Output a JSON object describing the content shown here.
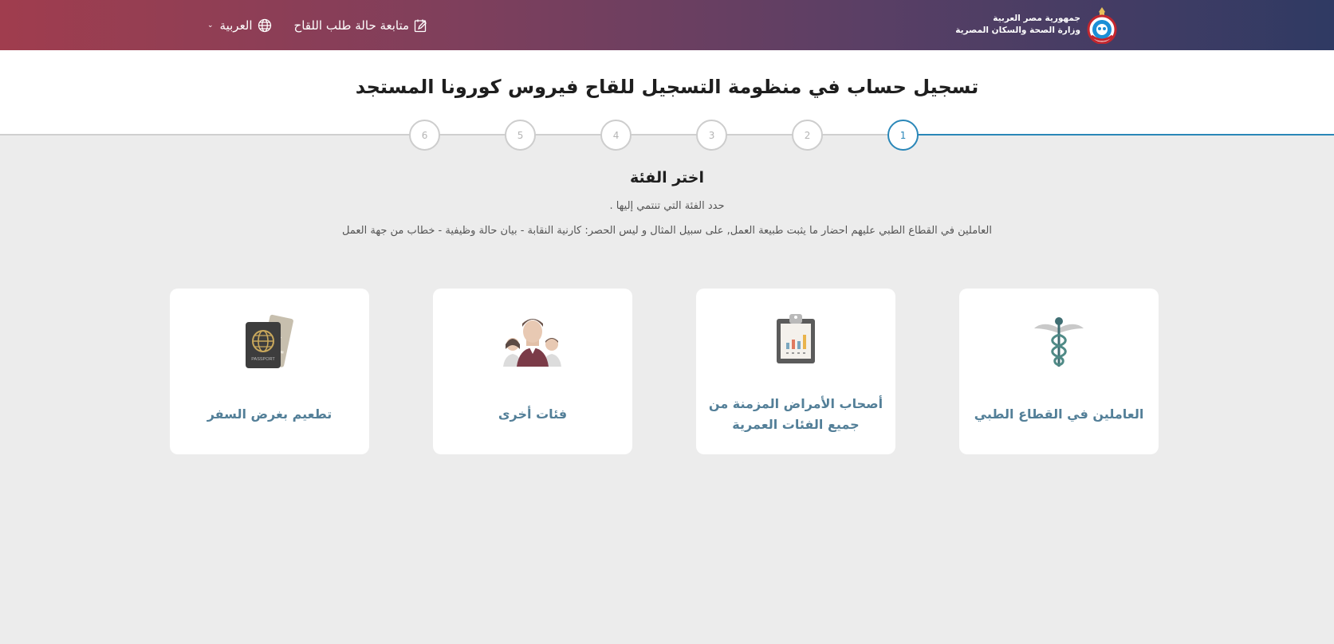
{
  "header": {
    "brand_line1": "جمهورية مصر العربية",
    "brand_line2": "وزارة الصحة والسكان المصرية",
    "track_label": "متابعة حالة طلب اللقاح",
    "language_label": "العربية",
    "colors": {
      "gradient_start": "#a03d4e",
      "gradient_end": "#2f3a63"
    }
  },
  "page_title": "تسجيل حساب في منظومة التسجيل للقاح فيروس كورونا المستجد",
  "stepper": {
    "steps": [
      "1",
      "2",
      "3",
      "4",
      "5",
      "6"
    ],
    "active": "1",
    "active_color": "#2a87b8"
  },
  "section": {
    "title": "اختر الفئة",
    "subtitle": "حدد الفئة التي تنتمي إليها .",
    "note": "العاملين في القطاع الطبي عليهم احضار ما يثبت طبيعة العمل, على سبيل المثال و ليس الحصر: كارنية النقابة - بيان حالة وظيفية - خطاب من جهة العمل"
  },
  "categories": [
    {
      "label": "العاملين في القطاع الطبي",
      "icon": "caduceus-icon"
    },
    {
      "label": "أصحاب الأمراض المزمنة من جميع الفئات العمرية",
      "icon": "clipboard-chart-icon"
    },
    {
      "label": "فئات أخرى",
      "icon": "family-group-icon"
    },
    {
      "label": "تطعيم بغرض السفر",
      "icon": "passport-ticket-icon",
      "passport_text": "PASSPORT"
    }
  ],
  "label_color": "#537f98"
}
